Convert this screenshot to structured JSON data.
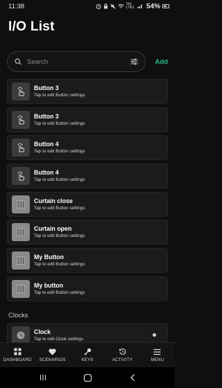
{
  "status_bar": {
    "time": "11:38",
    "network": "Vo) LTE1",
    "battery": "54%"
  },
  "page": {
    "title": "I/O List"
  },
  "search": {
    "placeholder": "Search",
    "add_label": "Add"
  },
  "buttons": [
    {
      "title": "Button 3",
      "subtitle": "Tap to edit Button settings",
      "icon": "tap-hand-icon"
    },
    {
      "title": "Button 3",
      "subtitle": "Tap to edit Button settings",
      "icon": "tap-hand-icon"
    },
    {
      "title": "Button 4",
      "subtitle": "Tap to edit Button settings",
      "icon": "tap-hand-icon"
    },
    {
      "title": "Button 4",
      "subtitle": "Tap to edit Button settings",
      "icon": "tap-hand-icon"
    },
    {
      "title": "Curtain close",
      "subtitle": "Tap to edit Button settings",
      "icon": "curtain-icon"
    },
    {
      "title": "Curtain open",
      "subtitle": "Tap to edit Button settings",
      "icon": "curtain-icon"
    },
    {
      "title": "My Button",
      "subtitle": "Tap to edit Button settings",
      "icon": "curtain-icon"
    },
    {
      "title": "My button",
      "subtitle": "Tap to edit Button settings",
      "icon": "curtain-icon"
    }
  ],
  "clocks_section": {
    "header": "Clocks",
    "items": [
      {
        "title": "Clock",
        "subtitle": "Tap to edit Clock settings",
        "icon": "clock-icon"
      }
    ]
  },
  "bottom_nav": [
    {
      "label": "DASHBOARD",
      "icon": "grid-icon"
    },
    {
      "label": "SCENARIOS",
      "icon": "heart-icon"
    },
    {
      "label": "KEYS",
      "icon": "key-icon"
    },
    {
      "label": "ACTIVITY",
      "icon": "history-icon"
    },
    {
      "label": "MENU",
      "icon": "hamburger-icon"
    }
  ],
  "colors": {
    "accent": "#29c38a",
    "background": "#0f0f0f",
    "card": "#1b1b1b"
  }
}
